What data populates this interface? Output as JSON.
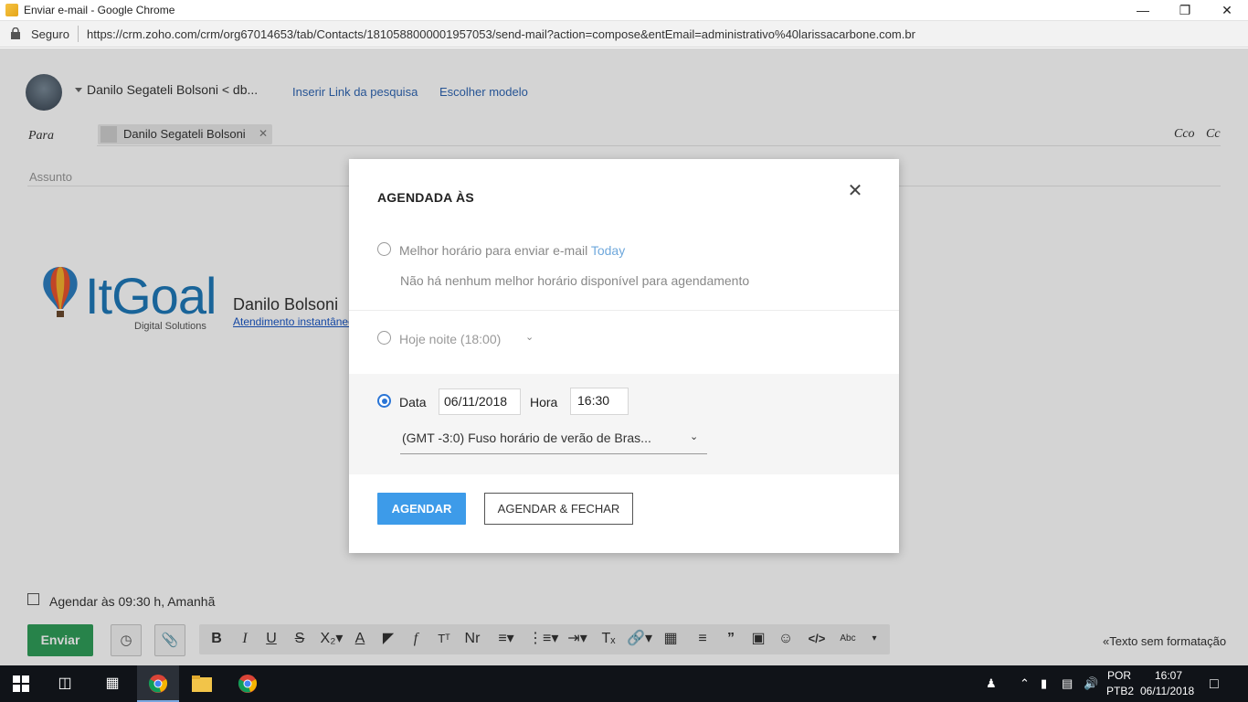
{
  "window": {
    "title": "Enviar e-mail - Google Chrome"
  },
  "addressbar": {
    "secure_label": "Seguro",
    "url": "https://crm.zoho.com/crm/org67014653/tab/Contacts/1810588000001957053/send-mail?action=compose&entEmail=administrativo%40larissacarbone.com.br"
  },
  "compose": {
    "from": "Danilo Segateli Bolsoni < db...",
    "insert_link": "Inserir Link da pesquisa",
    "choose_template": "Escolher modelo",
    "to_label": "Para",
    "recipient": "Danilo Segateli Bolsoni",
    "cco": "Cco",
    "cc": "Cc",
    "subject_placeholder": "Assunto",
    "signature": {
      "logo_text": "ItGoal",
      "logo_sub": "Digital Solutions",
      "name": "Danilo Bolsoni",
      "link": "Atendimento instantâneo"
    },
    "schedule_checkbox": "Agendar às 09:30 h, Amanhã",
    "send": "Enviar",
    "plain_text": "Texto sem formatação"
  },
  "modal": {
    "title": "AGENDADA ÀS",
    "option_best": "Melhor horário para enviar e-mail",
    "option_best_link": "Today",
    "option_best_sub": "Não há nenhum melhor horário disponível para agendamento",
    "option_tonight": "Hoje noite (18:00)",
    "date_label": "Data",
    "date_value": "06/11/2018",
    "time_label": "Hora",
    "time_value": "16:30",
    "timezone": "(GMT -3:0) Fuso horário de verão de Bras...",
    "btn_schedule": "AGENDAR",
    "btn_schedule_close": "AGENDAR & FECHAR"
  },
  "taskbar": {
    "lang1": "POR",
    "lang2": "PTB2",
    "time": "16:07",
    "date": "06/11/2018"
  }
}
